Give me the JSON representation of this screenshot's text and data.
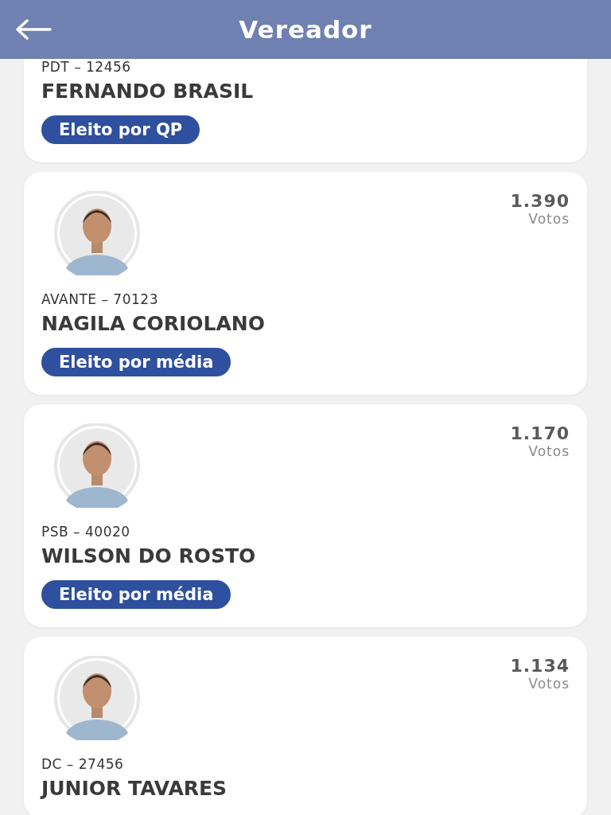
{
  "header": {
    "title": "Vereador"
  },
  "candidates": [
    {
      "party": "PDT – 12456",
      "name": "FERNANDO BRASIL",
      "badge": "Eleito por QP",
      "photo": false
    },
    {
      "party": "AVANTE – 70123",
      "name": "NAGILA CORIOLANO",
      "badge": "Eleito por média",
      "photo": true,
      "votes": "1.390",
      "votes_label": "Votos"
    },
    {
      "party": "PSB – 40020",
      "name": "WILSON DO ROSTO",
      "badge": "Eleito por média",
      "photo": true,
      "votes": "1.170",
      "votes_label": "Votos"
    },
    {
      "party": "DC – 27456",
      "name": "JUNIOR TAVARES",
      "photo": true,
      "votes": "1.134",
      "votes_label": "Votos"
    }
  ]
}
